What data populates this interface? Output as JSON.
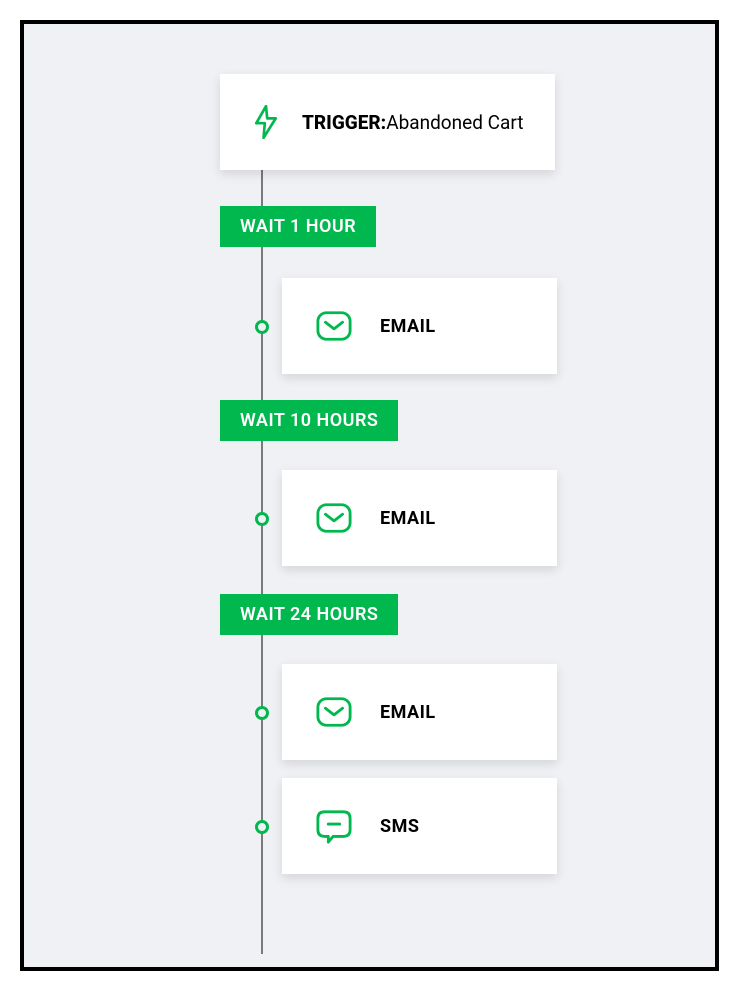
{
  "trigger": {
    "label": "TRIGGER:",
    "value": "Abandoned Cart",
    "icon": "bolt-icon"
  },
  "steps": [
    {
      "wait_label": "WAIT 1 HOUR",
      "actions": [
        {
          "icon": "email-icon",
          "label": "EMAIL"
        }
      ]
    },
    {
      "wait_label": "WAIT 10 HOURS",
      "actions": [
        {
          "icon": "email-icon",
          "label": "EMAIL"
        }
      ]
    },
    {
      "wait_label": "WAIT 24 HOURS",
      "actions": [
        {
          "icon": "email-icon",
          "label": "EMAIL"
        },
        {
          "icon": "sms-icon",
          "label": "SMS"
        }
      ]
    }
  ],
  "colors": {
    "accent": "#00b84d",
    "bg": "#f0f1f5"
  }
}
